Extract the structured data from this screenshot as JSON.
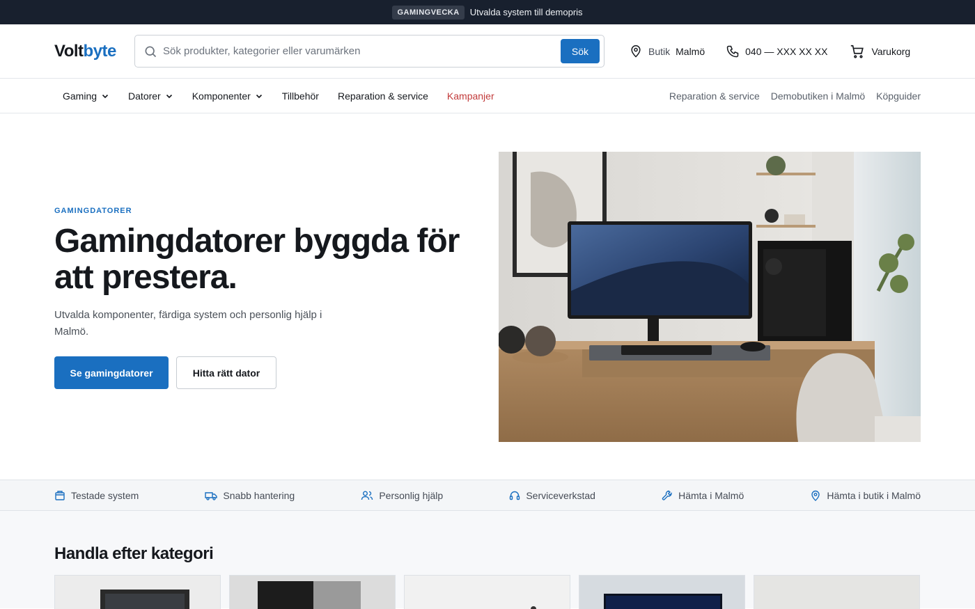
{
  "announcement": {
    "badge": "GAMINGVECKA",
    "message": "Utvalda system till demopris"
  },
  "header": {
    "logo_a": "Volt",
    "logo_b": "byte",
    "search_placeholder": "Sök produkter, kategorier eller varumärken",
    "search_button": "Sök",
    "store_label": "Butik",
    "store_city": "Malmö",
    "phone": "040 — XXX XX XX",
    "cart": "Varukorg"
  },
  "nav": {
    "items": [
      {
        "label": "Gaming",
        "dropdown": true
      },
      {
        "label": "Datorer",
        "dropdown": true
      },
      {
        "label": "Komponenter",
        "dropdown": true
      },
      {
        "label": "Tillbehör",
        "dropdown": false
      },
      {
        "label": "Reparation & service",
        "dropdown": false
      },
      {
        "label": "Kampanjer",
        "dropdown": false
      }
    ],
    "right": [
      "Reparation & service",
      "Demobutiken i Malmö",
      "Köpguider"
    ]
  },
  "hero": {
    "eyebrow": "GAMINGDATORER",
    "title": "Gamingdatorer byggda för att prestera.",
    "subtitle": "Utvalda komponenter, färdiga system och personlig hjälp i Malmö.",
    "cta_primary": "Se gamingdatorer",
    "cta_secondary": "Hitta rätt dator"
  },
  "features": [
    {
      "label": "Testade system",
      "icon": "box-icon"
    },
    {
      "label": "Snabb hantering",
      "icon": "truck-icon"
    },
    {
      "label": "Personlig hjälp",
      "icon": "users-icon"
    },
    {
      "label": "Serviceverkstad",
      "icon": "headset-icon"
    },
    {
      "label": "Hämta i Malmö",
      "icon": "wrench-icon"
    },
    {
      "label": "Hämta i butik i Malmö",
      "icon": "map-pin-icon"
    }
  ],
  "categories": {
    "title": "Handla efter kategori"
  },
  "colors": {
    "accent": "#1a6fc0",
    "campaign": "#c23a3a",
    "topbar": "#18202e"
  }
}
